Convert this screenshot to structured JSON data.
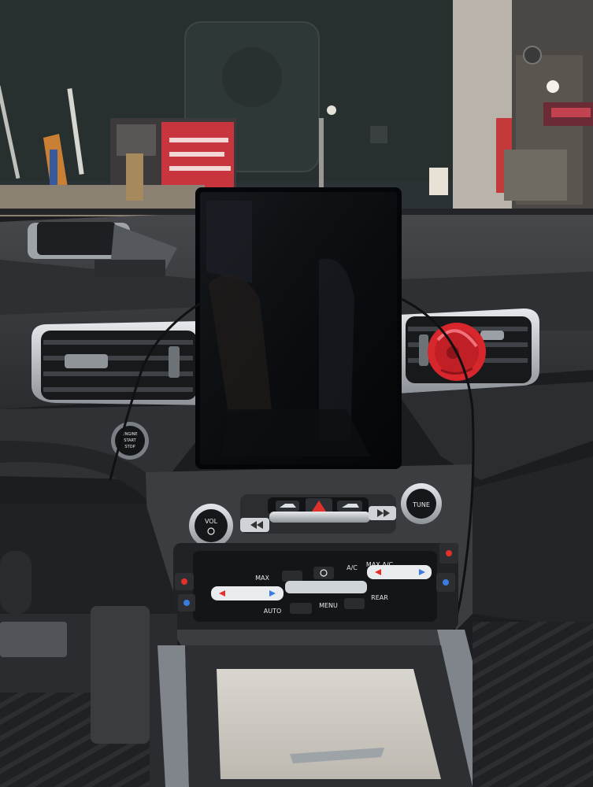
{
  "scene": {
    "description_kind": "photo",
    "colors": {
      "background_shop": "#2b3236",
      "dashboard": "#3a3c40",
      "screen": "#0b0d10",
      "vent_chrome": "#b8bcc0",
      "phone_holder_red": "#d8262d",
      "hazard_red": "#e0322b",
      "button_backlight": "#e8ecef"
    }
  },
  "controls": {
    "engine_start": {
      "line1": "ENGINE",
      "line2": "START",
      "line3": "STOP"
    },
    "vol_knob": {
      "label": "VOL"
    },
    "tune_knob": {
      "label": "TUNE"
    },
    "climate": {
      "max_defrost": "MAX",
      "ac": "A/C",
      "max_ac": "MAX A/C",
      "auto": "AUTO",
      "menu": "MENU",
      "rear": "REAR"
    }
  }
}
